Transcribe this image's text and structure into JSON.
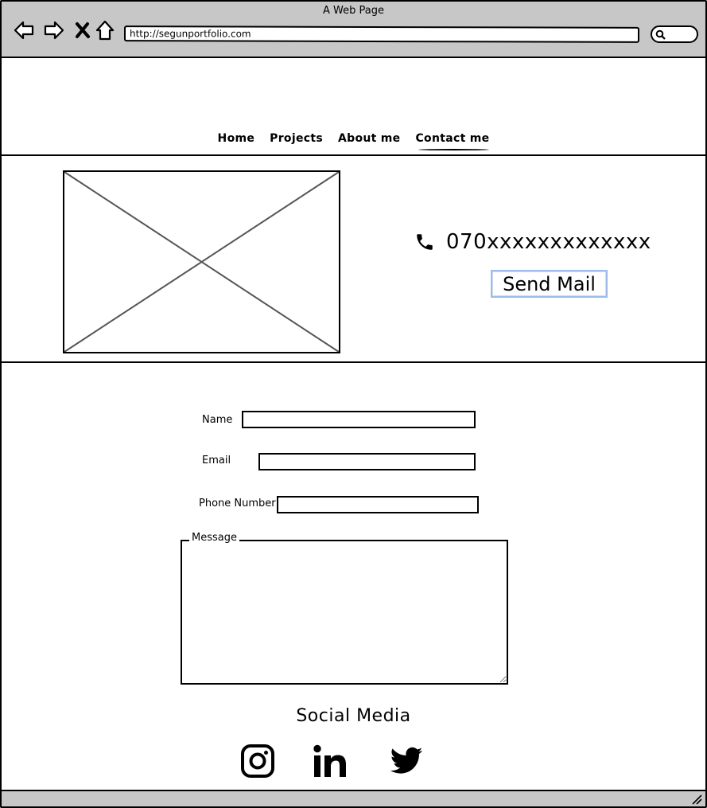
{
  "browser": {
    "title": "A Web Page",
    "url": "http://segunportfolio.com"
  },
  "nav": {
    "items": [
      {
        "label": "Home"
      },
      {
        "label": "Projects"
      },
      {
        "label": "About me"
      },
      {
        "label": "Contact me"
      }
    ],
    "active_index": 3
  },
  "hero": {
    "phone": "070xxxxxxxxxxxxx",
    "send_mail_label": "Send Mail"
  },
  "form": {
    "name_label": "Name",
    "email_label": "Email",
    "phone_label": "Phone Number",
    "message_label": "Message"
  },
  "footer": {
    "title": "Social Media",
    "icons": [
      "instagram-icon",
      "linkedin-icon",
      "twitter-icon"
    ]
  },
  "colors": {
    "chrome": "#c7c7c7",
    "button_border": "#9ebbe9",
    "placeholder_lines": "#555555"
  }
}
